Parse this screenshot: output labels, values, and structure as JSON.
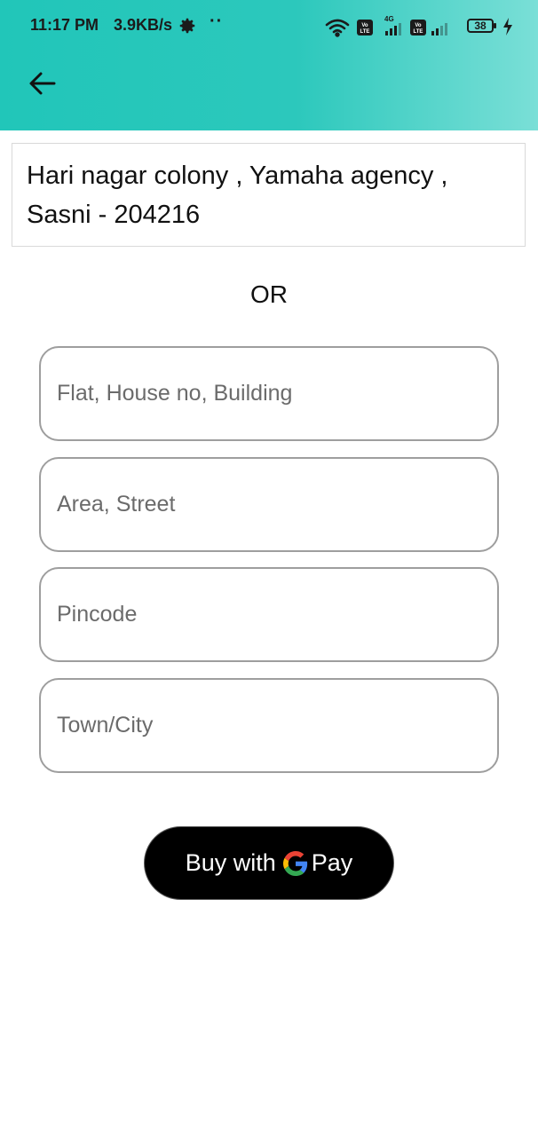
{
  "status_bar": {
    "time": "11:17 PM",
    "speed": "3.9KB/s",
    "dots": "··",
    "battery": "38",
    "icons": [
      "settings-gear-icon",
      "wifi-icon",
      "volte-icon",
      "signal-4g-icon",
      "volte-icon",
      "signal-icon",
      "battery-icon",
      "charging-icon"
    ]
  },
  "app_bar": {
    "back_icon": "arrow-back-icon",
    "colors": {
      "gradient_start": "#21c6b9",
      "gradient_end": "#7adfd7"
    }
  },
  "address": {
    "text": "Hari nagar colony , Yamaha agency , Sasni - 204216"
  },
  "or_label": "OR",
  "form": {
    "fields": [
      {
        "placeholder": "Flat, House no, Building",
        "value": ""
      },
      {
        "placeholder": "Area, Street",
        "value": ""
      },
      {
        "placeholder": "Pincode",
        "value": ""
      },
      {
        "placeholder": "Town/City",
        "value": ""
      }
    ]
  },
  "gpay_button": {
    "prefix": "Buy with",
    "suffix": "Pay",
    "logo_icon": "google-g-icon",
    "color": "#000000"
  }
}
